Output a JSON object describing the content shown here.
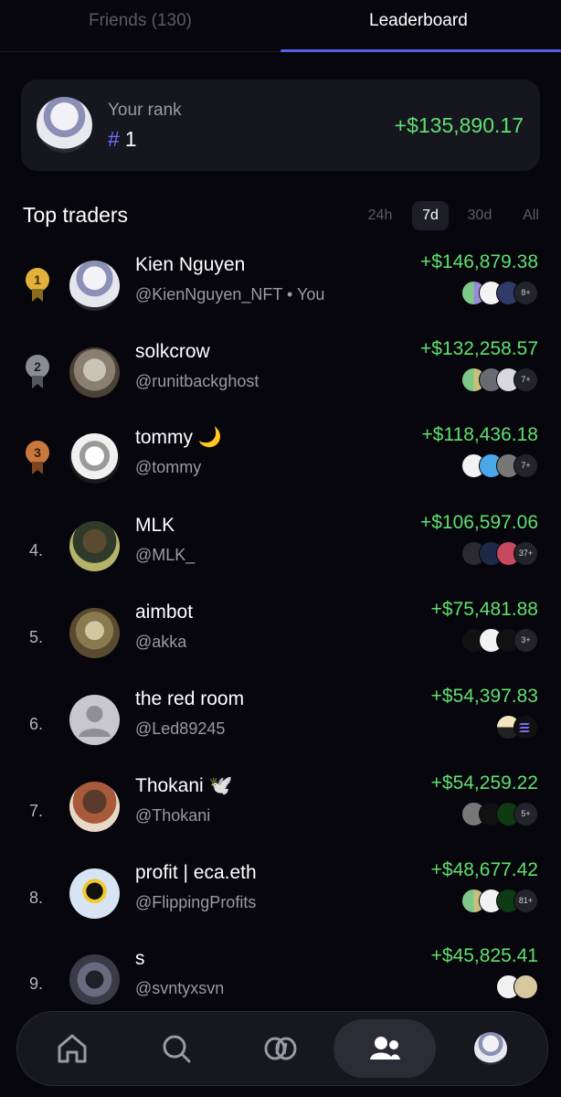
{
  "tabs": {
    "friends": "Friends (130)",
    "leaderboard": "Leaderboard",
    "active": "leaderboard"
  },
  "your_rank": {
    "label": "Your rank",
    "hash": "#",
    "rank": "1",
    "pnl": "+$135,890.17"
  },
  "top_traders": {
    "title": "Top traders",
    "filters": [
      "24h",
      "7d",
      "30d",
      "All"
    ],
    "active_filter": "7d"
  },
  "traders": [
    {
      "rank": "1",
      "medal": "gold",
      "name": "Kien Nguyen",
      "handle": "@KienNguyen_NFT • You",
      "pnl": "+$146,879.38",
      "token_more": "8+"
    },
    {
      "rank": "2",
      "medal": "silver",
      "name": "solkcrow",
      "handle": "@runitbackghost",
      "pnl": "+$132,258.57",
      "token_more": "7+"
    },
    {
      "rank": "3",
      "medal": "bronze",
      "name": "tommy 🌙",
      "handle": "@tommy",
      "pnl": "+$118,436.18",
      "token_more": "7+"
    },
    {
      "rank": "4.",
      "medal": "",
      "name": "MLK",
      "handle": "@MLK_",
      "pnl": "+$106,597.06",
      "token_more": "37+"
    },
    {
      "rank": "5.",
      "medal": "",
      "name": "aimbot",
      "handle": "@akka",
      "pnl": "+$75,481.88",
      "token_more": "3+"
    },
    {
      "rank": "6.",
      "medal": "",
      "name": "the red room",
      "handle": "@Led89245",
      "pnl": "+$54,397.83",
      "token_more": ""
    },
    {
      "rank": "7.",
      "medal": "",
      "name": "Thokani 🕊️",
      "handle": "@Thokani",
      "pnl": "+$54,259.22",
      "token_more": "5+"
    },
    {
      "rank": "8.",
      "medal": "",
      "name": "profit | eca.eth",
      "handle": "@FlippingProfits",
      "pnl": "+$48,677.42",
      "token_more": "81+"
    },
    {
      "rank": "9.",
      "medal": "",
      "name": "s",
      "handle": "@svntyxsvn",
      "pnl": "+$45,825.41",
      "token_more": ""
    }
  ],
  "bottom_nav": {
    "items": [
      "home-icon",
      "search-icon",
      "swap-icon",
      "friends-icon",
      "profile-avatar"
    ],
    "active": "friends-icon"
  },
  "colors": {
    "accent": "#5561e8",
    "positive": "#5fe06f",
    "background": "#06060c",
    "card": "#16161e"
  }
}
